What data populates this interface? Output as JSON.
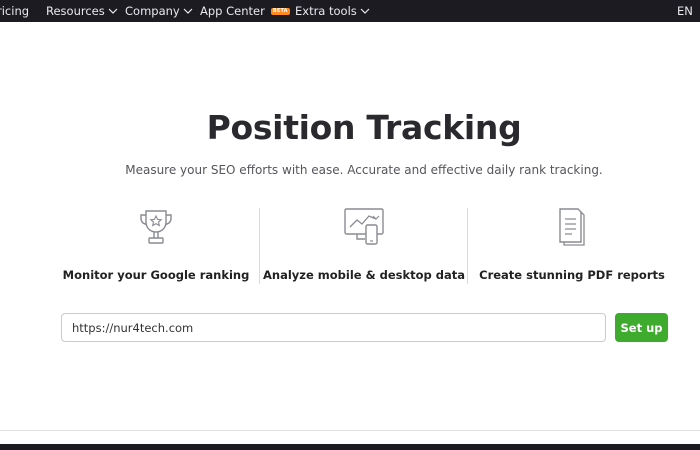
{
  "nav": {
    "items": [
      {
        "label": "ricing",
        "dropdown": false
      },
      {
        "label": "Resources",
        "dropdown": true
      },
      {
        "label": "Company",
        "dropdown": true
      },
      {
        "label": "App Center",
        "dropdown": false,
        "badge": "BETA"
      },
      {
        "label": "Extra tools",
        "dropdown": true
      }
    ],
    "language": "EN",
    "colors": {
      "background": "#1c1b22",
      "badge": "#ff8a1f"
    }
  },
  "hero": {
    "title": "Position Tracking",
    "subtitle": "Measure your SEO efforts with ease. Accurate and effective daily rank tracking."
  },
  "features": [
    {
      "icon": "trophy-icon",
      "label": "Monitor your Google ranking"
    },
    {
      "icon": "desktop-mobile-chart-icon",
      "label": "Analyze mobile & desktop data"
    },
    {
      "icon": "pdf-report-icon",
      "label": "Create stunning PDF reports"
    }
  ],
  "form": {
    "url_value": "https://nur4tech.com",
    "submit_label": "Set up",
    "submit_color": "#3fab2e"
  }
}
